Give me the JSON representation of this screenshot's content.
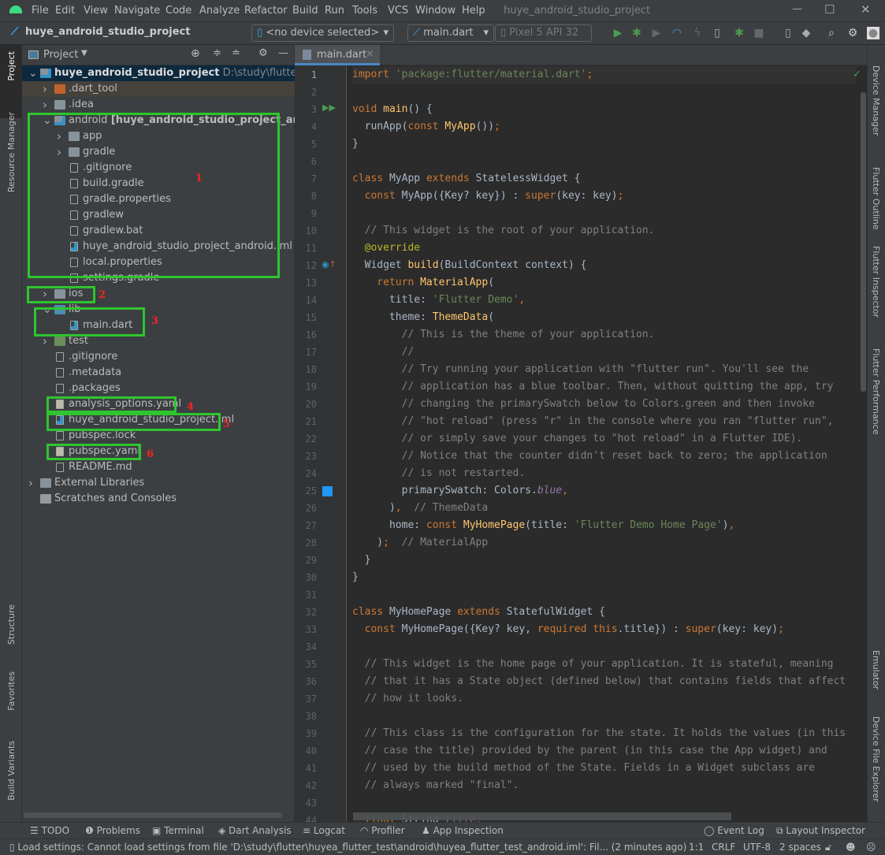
{
  "window": {
    "title": "huye_android_studio_project",
    "menu": [
      "File",
      "Edit",
      "View",
      "Navigate",
      "Code",
      "Analyze",
      "Refactor",
      "Build",
      "Run",
      "Tools",
      "VCS",
      "Window",
      "Help"
    ]
  },
  "toolbar": {
    "project_name": "huye_android_studio_project",
    "device_selector": "<no device selected>",
    "run_config": "main.dart",
    "emulator": "Pixel 5 API 32"
  },
  "left_stripe": [
    "Project",
    "Resource Manager",
    "Structure",
    "Favorites",
    "Build Variants"
  ],
  "right_stripe": [
    "Device Manager",
    "Flutter Outline",
    "Flutter Inspector",
    "Flutter Performance",
    "Emulator",
    "Device File Explorer"
  ],
  "project_panel": {
    "title": "Project",
    "tree": [
      {
        "label": "huye_android_studio_project",
        "bold": true,
        "suffix": "D:\\study\\flutter\\huye_",
        "level": 0,
        "state": "open",
        "icon": "module-folder",
        "selected": true
      },
      {
        "label": ".dart_tool",
        "level": 1,
        "state": "closed",
        "icon": "excluded-folder"
      },
      {
        "label": ".idea",
        "level": 1,
        "state": "closed",
        "icon": "settings-folder"
      },
      {
        "label": "android",
        "bold_suffix": "[huye_android_studio_project_android]",
        "level": 1,
        "state": "open",
        "icon": "module-folder"
      },
      {
        "label": "app",
        "level": 2,
        "state": "closed",
        "icon": "folder"
      },
      {
        "label": "gradle",
        "level": 2,
        "state": "closed",
        "icon": "folder"
      },
      {
        "label": ".gitignore",
        "level": 2,
        "icon": "ignore-file"
      },
      {
        "label": "build.gradle",
        "level": 2,
        "icon": "gradle-file"
      },
      {
        "label": "gradle.properties",
        "level": 2,
        "icon": "properties-file"
      },
      {
        "label": "gradlew",
        "level": 2,
        "icon": "shell-file"
      },
      {
        "label": "gradlew.bat",
        "level": 2,
        "icon": "text-file"
      },
      {
        "label": "huye_android_studio_project_android.iml",
        "level": 2,
        "icon": "iml-file"
      },
      {
        "label": "local.properties",
        "level": 2,
        "icon": "properties-file"
      },
      {
        "label": "settings.gradle",
        "level": 2,
        "icon": "gradle-file"
      },
      {
        "label": "ios",
        "level": 1,
        "state": "closed",
        "icon": "folder"
      },
      {
        "label": "lib",
        "level": 1,
        "state": "open",
        "icon": "source-folder"
      },
      {
        "label": "main.dart",
        "level": 2,
        "icon": "dart-file"
      },
      {
        "label": "test",
        "level": 1,
        "state": "closed",
        "icon": "test-folder"
      },
      {
        "label": ".gitignore",
        "level": 1,
        "icon": "ignore-file"
      },
      {
        "label": ".metadata",
        "level": 1,
        "icon": "text-file"
      },
      {
        "label": ".packages",
        "level": 1,
        "icon": "text-file"
      },
      {
        "label": "analysis_options.yaml",
        "level": 1,
        "icon": "yaml-file"
      },
      {
        "label": "huye_android_studio_project.iml",
        "level": 1,
        "icon": "iml-file"
      },
      {
        "label": "pubspec.lock",
        "level": 1,
        "icon": "text-file"
      },
      {
        "label": "pubspec.yaml",
        "level": 1,
        "icon": "yaml-file"
      },
      {
        "label": "README.md",
        "level": 1,
        "icon": "markdown-file"
      },
      {
        "label": "External Libraries",
        "level": 0,
        "state": "closed",
        "icon": "library"
      },
      {
        "label": "Scratches and Consoles",
        "level": 0,
        "icon": "scratches"
      }
    ],
    "annotations": [
      "1",
      "2",
      "3",
      "4",
      "5",
      "6"
    ],
    "highlight_color": "#2ec52e",
    "annotation_color": "#ff2020"
  },
  "editor": {
    "tab": "main.dart",
    "lines": [
      [
        [
          "kw",
          "import "
        ],
        [
          "st",
          "'package:flutter/material.dart'"
        ],
        [
          "kw",
          ";"
        ]
      ],
      [],
      [
        [
          "kw",
          "void "
        ],
        [
          "fn",
          "main"
        ],
        [
          "",
          "() {"
        ]
      ],
      [
        [
          "",
          "  runApp("
        ],
        [
          "kw",
          "const "
        ],
        [
          "cn",
          "MyApp"
        ],
        [
          "",
          "())"
        ],
        [
          "kw",
          ";"
        ]
      ],
      [
        [
          "",
          "}"
        ]
      ],
      [],
      [
        [
          "kw",
          "class "
        ],
        [
          "",
          "MyApp "
        ],
        [
          "kw",
          "extends "
        ],
        [
          "",
          "StatelessWidget {"
        ]
      ],
      [
        [
          "kw",
          "  const "
        ],
        [
          "",
          "MyApp({Key? key}) : "
        ],
        [
          "kw",
          "super"
        ],
        [
          "",
          "(key: key)"
        ],
        [
          "kw",
          ";"
        ]
      ],
      [],
      [
        [
          "cm",
          "  // This widget is the root of your application."
        ]
      ],
      [
        [
          "an",
          "  @override"
        ]
      ],
      [
        [
          "",
          "  Widget "
        ],
        [
          "fn",
          "build"
        ],
        [
          "",
          "(BuildContext context) {"
        ]
      ],
      [
        [
          "kw",
          "    return "
        ],
        [
          "cn",
          "MaterialApp"
        ],
        [
          "",
          "("
        ]
      ],
      [
        [
          "",
          "      title: "
        ],
        [
          "st",
          "'Flutter Demo'"
        ],
        [
          "kw",
          ","
        ]
      ],
      [
        [
          "",
          "      theme: "
        ],
        [
          "cn",
          "ThemeData"
        ],
        [
          "",
          "("
        ]
      ],
      [
        [
          "cm",
          "        // This is the theme of your application."
        ]
      ],
      [
        [
          "cm",
          "        //"
        ]
      ],
      [
        [
          "cm",
          "        // Try running your application with \"flutter run\". You'll see the"
        ]
      ],
      [
        [
          "cm",
          "        // application has a blue toolbar. Then, without quitting the app, try"
        ]
      ],
      [
        [
          "cm",
          "        // changing the primarySwatch below to Colors.green and then invoke"
        ]
      ],
      [
        [
          "cm",
          "        // \"hot reload\" (press \"r\" in the console where you ran \"flutter run\","
        ]
      ],
      [
        [
          "cm",
          "        // or simply save your changes to \"hot reload\" in a Flutter IDE)."
        ]
      ],
      [
        [
          "cm",
          "        // Notice that the counter didn't reset back to zero; the application"
        ]
      ],
      [
        [
          "cm",
          "        // is not restarted."
        ]
      ],
      [
        [
          "",
          "        primarySwatch: Colors."
        ],
        [
          "it",
          "blue"
        ],
        [
          "kw",
          ","
        ]
      ],
      [
        [
          "",
          "      )"
        ],
        [
          "kw",
          ","
        ],
        [
          "cm",
          "  // ThemeData"
        ]
      ],
      [
        [
          "",
          "      home: "
        ],
        [
          "kw",
          "const "
        ],
        [
          "cn",
          "MyHomePage"
        ],
        [
          "",
          "(title: "
        ],
        [
          "st",
          "'Flutter Demo Home Page'"
        ],
        [
          "",
          ")"
        ],
        [
          "kw",
          ","
        ]
      ],
      [
        [
          "",
          "    )"
        ],
        [
          "kw",
          ";"
        ],
        [
          "cm",
          "  // MaterialApp"
        ]
      ],
      [
        [
          "",
          "  }"
        ]
      ],
      [
        [
          "",
          "}"
        ]
      ],
      [],
      [
        [
          "kw",
          "class "
        ],
        [
          "",
          "MyHomePage "
        ],
        [
          "kw",
          "extends "
        ],
        [
          "",
          "StatefulWidget {"
        ]
      ],
      [
        [
          "kw",
          "  const "
        ],
        [
          "",
          "MyHomePage({Key? key, "
        ],
        [
          "kw",
          "required this"
        ],
        [
          "",
          ".title}) : "
        ],
        [
          "kw",
          "super"
        ],
        [
          "",
          "(key: key)"
        ],
        [
          "kw",
          ";"
        ]
      ],
      [],
      [
        [
          "cm",
          "  // This widget is the home page of your application. It is stateful, meaning"
        ]
      ],
      [
        [
          "cm",
          "  // that it has a State object (defined below) that contains fields that affect"
        ]
      ],
      [
        [
          "cm",
          "  // how it looks."
        ]
      ],
      [],
      [
        [
          "cm",
          "  // This class is the configuration for the state. It holds the values (in this"
        ]
      ],
      [
        [
          "cm",
          "  // case the title) provided by the parent (in this case the App widget) and"
        ]
      ],
      [
        [
          "cm",
          "  // used by the build method of the State. Fields in a Widget subclass are"
        ]
      ],
      [
        [
          "cm",
          "  // always marked \"final\"."
        ]
      ],
      [],
      [
        [
          "kw",
          "  final "
        ],
        [
          "",
          "String "
        ],
        [
          "fd",
          "title"
        ],
        [
          "kw",
          ";"
        ]
      ]
    ]
  },
  "bottom_tools": [
    "TODO",
    "Problems",
    "Terminal",
    "Dart Analysis",
    "Logcat",
    "Profiler",
    "App Inspection",
    "Event Log",
    "Layout Inspector"
  ],
  "status": {
    "message": "Load settings: Cannot load settings from file 'D:\\study\\flutter\\huyea_flutter_test\\android\\huyea_flutter_test_android.iml': Fil... (2 minutes ago)",
    "position": "1:1",
    "line_sep": "CRLF",
    "encoding": "UTF-8",
    "indent": "2 spaces"
  }
}
